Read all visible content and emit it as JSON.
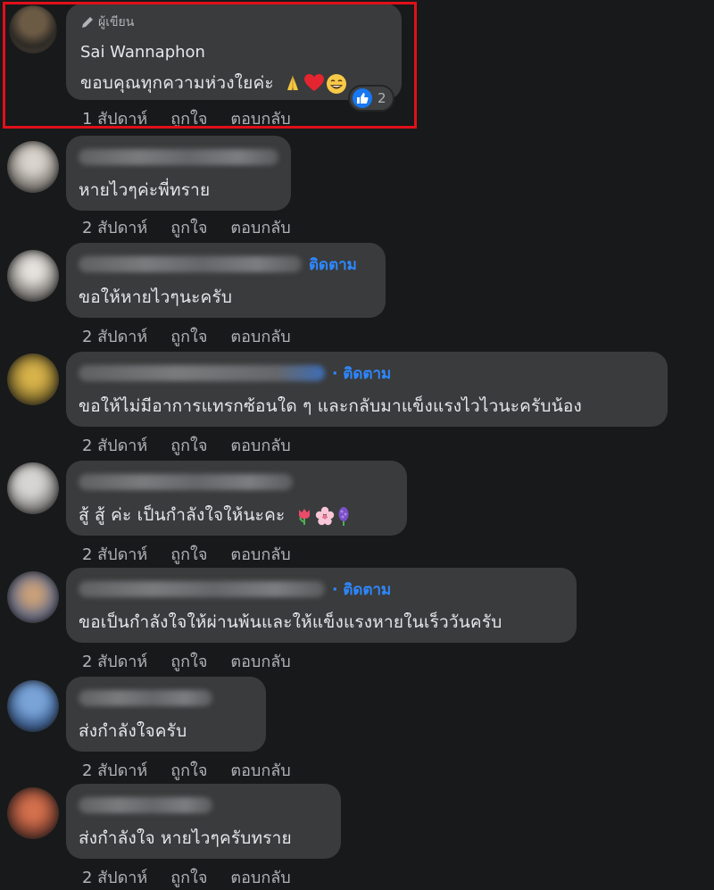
{
  "author_comment": {
    "badge": "ผู้เขียน",
    "name": "Sai Wannaphon",
    "text": "ขอบคุณทุกความห่วงใยค่ะ",
    "reaction_count": "2",
    "time": "1 สัปดาห์",
    "like": "ถูกใจ",
    "reply": "ตอบกลับ",
    "emoji_icons": [
      "folded-hands-icon",
      "red-heart-icon",
      "grinning-face-icon"
    ]
  },
  "comments": [
    {
      "text": "หายไวๆค่ะพี่ทราย",
      "follow": "",
      "time": "2 สัปดาห์",
      "like": "ถูกใจ",
      "reply": "ตอบกลับ"
    },
    {
      "text": "ขอให้หายไวๆนะครับ",
      "follow": "ติดตาม",
      "time": "2 สัปดาห์",
      "like": "ถูกใจ",
      "reply": "ตอบกลับ"
    },
    {
      "text": "ขอให้ไม่มีอาการแทรกซ้อนใด ๆ และกลับมาแข็งแรงไวไวนะครับน้อง",
      "follow": "· ติดตาม",
      "time": "2 สัปดาห์",
      "like": "ถูกใจ",
      "reply": "ตอบกลับ"
    },
    {
      "text": "สู้ สู้ ค่ะ เป็นกำลังใจให้นะคะ",
      "follow": "",
      "time": "2 สัปดาห์",
      "like": "ถูกใจ",
      "reply": "ตอบกลับ",
      "emoji_icons": [
        "tulip-icon",
        "cherry-blossom-icon",
        "hyacinth-icon"
      ]
    },
    {
      "text": "ขอเป็นกำลังใจให้ผ่านพ้นและให้แข็งแรงหายในเร็ววันครับ",
      "follow": "· ติดตาม",
      "time": "2 สัปดาห์",
      "like": "ถูกใจ",
      "reply": "ตอบกลับ"
    },
    {
      "text": "ส่งกำลังใจครับ",
      "follow": "",
      "time": "2 สัปดาห์",
      "like": "ถูกใจ",
      "reply": "ตอบกลับ"
    },
    {
      "text": "ส่งกำลังใจ หายไวๆครับทราย",
      "follow": "",
      "time": "2 สัปดาห์",
      "like": "ถูกใจ",
      "reply": "ตอบกลับ"
    }
  ],
  "colors": {
    "background": "#18191a",
    "bubble": "#3a3b3c",
    "link_blue": "#2d88ff",
    "highlight_red": "#e0101a"
  }
}
